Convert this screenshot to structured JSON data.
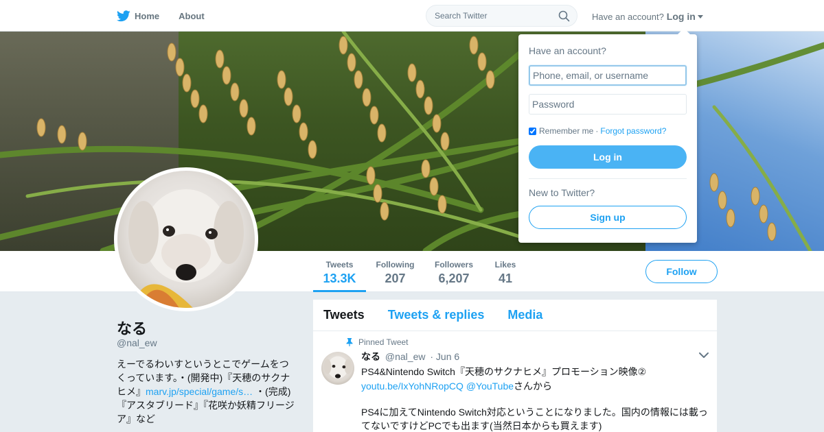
{
  "colors": {
    "brand": "#1da1f2",
    "bg": "#e6ecf0",
    "muted": "#657786"
  },
  "topnav": {
    "home_label": "Home",
    "about_label": "About",
    "search_placeholder": "Search Twitter",
    "account_prompt": "Have an account?",
    "login_label": "Log in"
  },
  "profile_nav": {
    "stats": [
      {
        "label": "Tweets",
        "value": "13.3K"
      },
      {
        "label": "Following",
        "value": "207"
      },
      {
        "label": "Followers",
        "value": "6,207"
      },
      {
        "label": "Likes",
        "value": "41"
      }
    ],
    "follow_label": "Follow"
  },
  "profile": {
    "name": "なる",
    "handle": "@nal_ew",
    "bio_text_1": "えーでるわいすというとこでゲームをつくっています。・(開発中)『天穂のサクナヒメ』",
    "bio_link": "marv.jp/special/game/s…",
    "bio_text_2": " ・(完成) 『アスタブリード』『花咲か妖精フリージア』など"
  },
  "timeline": {
    "tabs": [
      "Tweets",
      "Tweets & replies",
      "Media"
    ],
    "pinned_label": "Pinned Tweet",
    "tweet": {
      "name": "なる",
      "handle": "@nal_ew",
      "date": "· Jun 6",
      "line1": "PS4&Nintendo Switch『天穂のサクナヒメ』プロモーション映像②",
      "link": "youtu.be/IxYohNRopCQ",
      "mention": "@YouTube",
      "line2_suffix": "さんから",
      "line3": "PS4に加えてNintendo Switch対応ということになりました。国内の情報には載ってないですけどPCでも出ます(当然日本からも買えます)"
    }
  },
  "login_dropdown": {
    "title": "Have an account?",
    "username_placeholder": "Phone, email, or username",
    "password_placeholder": "Password",
    "remember_label": "Remember me",
    "separator": "·",
    "forgot_label": "Forgot password?",
    "login_button": "Log in",
    "new_label": "New to Twitter?",
    "signup_button": "Sign up"
  }
}
